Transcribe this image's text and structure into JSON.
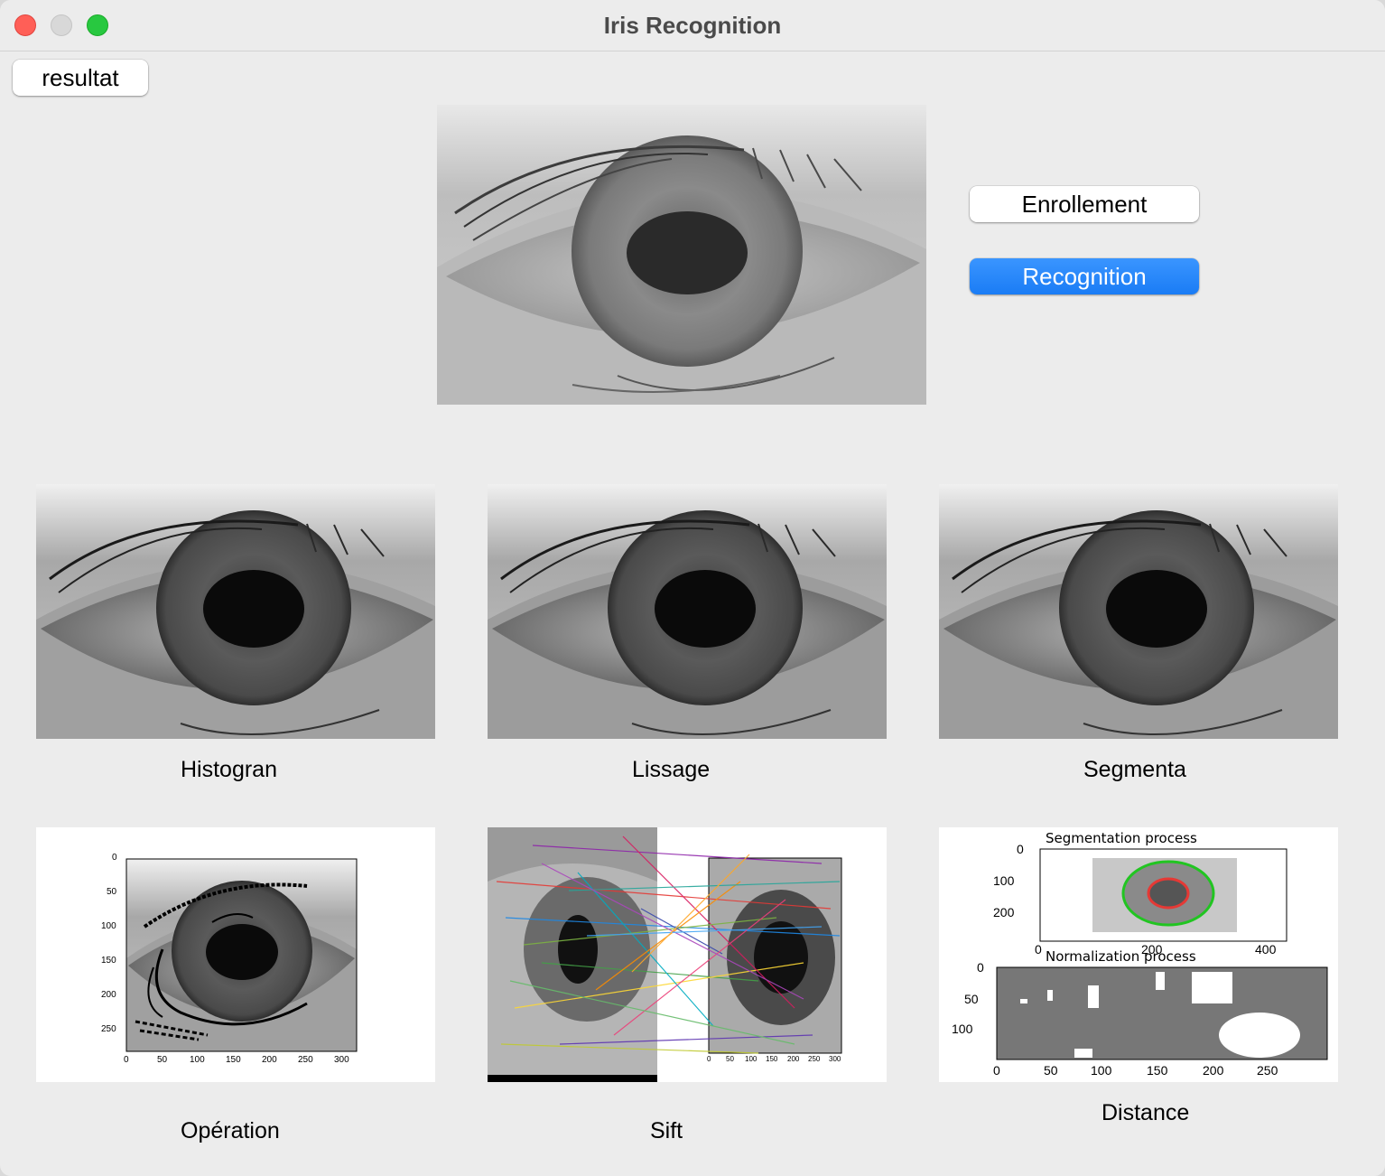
{
  "window": {
    "title": "Iris Recognition"
  },
  "toolbar": {
    "result_label": "resultat"
  },
  "actions": {
    "enroll_label": "Enrollement",
    "recognition_label": "Recognition"
  },
  "panels": {
    "histogram": {
      "caption": "Histogran"
    },
    "smoothing": {
      "caption": "Lissage"
    },
    "segmentation": {
      "caption": "Segmenta"
    },
    "operation": {
      "caption": "Opération",
      "y_ticks": [
        "0",
        "50",
        "100",
        "150",
        "200",
        "250"
      ],
      "x_ticks": [
        "0",
        "50",
        "100",
        "150",
        "200",
        "250",
        "300"
      ]
    },
    "sift": {
      "caption": "Sift",
      "x_ticks": [
        "0",
        "50",
        "100",
        "150",
        "200",
        "250",
        "300"
      ]
    },
    "distance": {
      "caption": "Distance",
      "top_title": "Segmentation process",
      "top_y_ticks": [
        "0",
        "100",
        "200"
      ],
      "top_x_ticks": [
        "0",
        "200",
        "400"
      ],
      "bottom_title": "Normalization process",
      "bottom_y_ticks": [
        "0",
        "50",
        "100"
      ],
      "bottom_x_ticks": [
        "0",
        "50",
        "100",
        "150",
        "200",
        "250"
      ]
    }
  },
  "colors": {
    "accent": "#1a7cf5",
    "close": "#ff5f57",
    "minimize": "#d8d8d8",
    "maximize": "#28c840"
  }
}
